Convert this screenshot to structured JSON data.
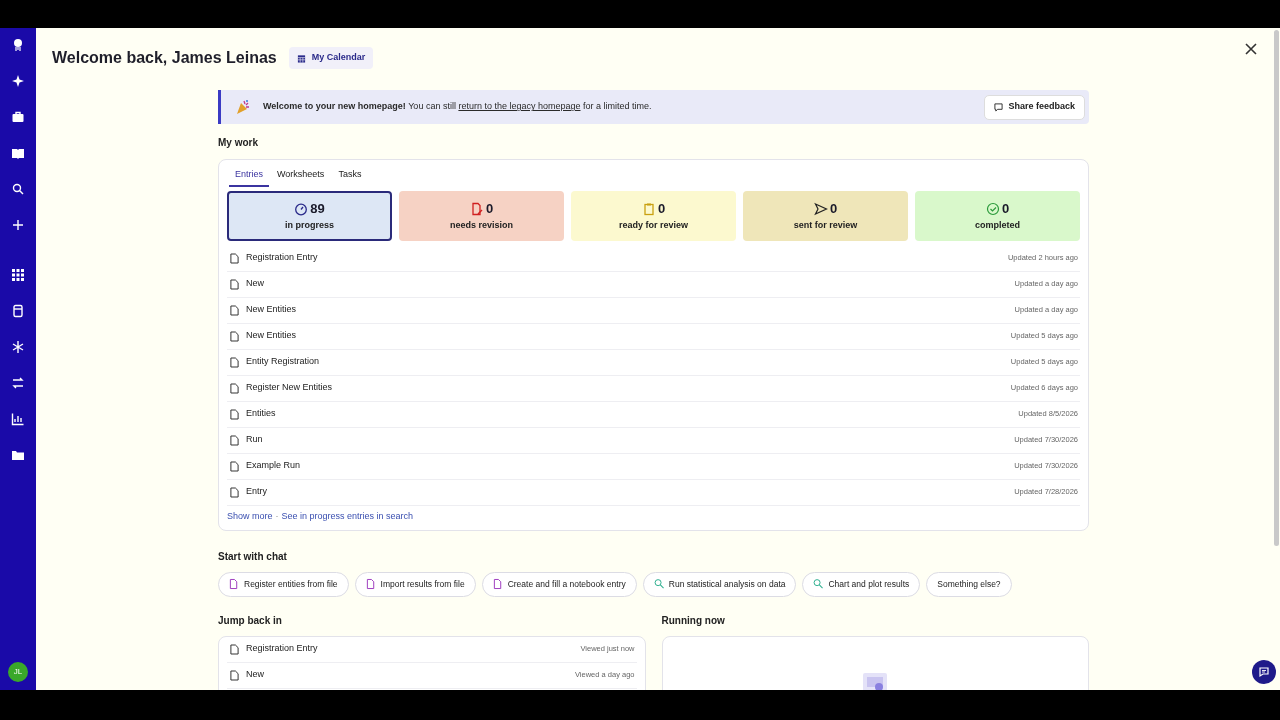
{
  "sidebar": {
    "icons": [
      {
        "kind": "logo"
      },
      {
        "kind": "sparkle"
      },
      {
        "kind": "briefcase"
      },
      {
        "kind": "book"
      },
      {
        "kind": "search"
      },
      {
        "kind": "plus"
      },
      {
        "kind": "grid"
      },
      {
        "kind": "cylinder"
      },
      {
        "kind": "snowflake"
      },
      {
        "kind": "arrows"
      },
      {
        "kind": "chart"
      },
      {
        "kind": "folder"
      }
    ],
    "avatar": "JL"
  },
  "header": {
    "title": "Welcome back, James Leinas",
    "calendar_button": "My Calendar"
  },
  "banner": {
    "lead": "Welcome to your new homepage!",
    "text": "You can still",
    "link": "return to the legacy homepage",
    "after": "for a limited time.",
    "button": "Share feedback"
  },
  "my_work": {
    "title": "My work",
    "tabs": [
      {
        "label": "Entries",
        "selected": true
      },
      {
        "label": "Worksheets",
        "selected": false
      },
      {
        "label": "Tasks",
        "selected": false
      }
    ],
    "status_cards": [
      {
        "kind": "progress",
        "count": "89",
        "label": "in progress",
        "selected": true,
        "color": "#dde7f5"
      },
      {
        "kind": "revision",
        "count": "0",
        "label": "needs revision",
        "selected": false,
        "color": "#f6d2c4"
      },
      {
        "kind": "ready",
        "count": "0",
        "label": "ready for review",
        "selected": false,
        "color": "#fcf9cf"
      },
      {
        "kind": "sent",
        "count": "0",
        "label": "sent for review",
        "selected": false,
        "color": "#efe6b9"
      },
      {
        "kind": "completed",
        "count": "0",
        "label": "completed",
        "selected": false,
        "color": "#d9f8cb"
      }
    ],
    "rows": [
      {
        "title": "Registration Entry",
        "updated": "Updated 2 hours ago"
      },
      {
        "title": "New",
        "updated": "Updated a day ago"
      },
      {
        "title": "New Entities",
        "updated": "Updated a day ago"
      },
      {
        "title": "New Entities",
        "updated": "Updated 5 days ago"
      },
      {
        "title": "Entity Registration",
        "updated": "Updated 5 days ago"
      },
      {
        "title": "Register New Entities",
        "updated": "Updated 6 days ago"
      },
      {
        "title": "Entities",
        "updated": "Updated 8/5/2026"
      },
      {
        "title": "Run",
        "updated": "Updated 7/30/2026"
      },
      {
        "title": "Example Run",
        "updated": "Updated 7/30/2026"
      },
      {
        "title": "Entry",
        "updated": "Updated 7/28/2026"
      }
    ],
    "footer_links": [
      "Show more",
      "See in progress entries in search"
    ],
    "separator": "·"
  },
  "start_with_chat": {
    "title": "Start with chat",
    "chips": [
      {
        "kind": "file",
        "label": "Register entities from file"
      },
      {
        "kind": "file",
        "label": "Import results from file"
      },
      {
        "kind": "file",
        "label": "Create and fill a notebook entry"
      },
      {
        "kind": "analysis",
        "label": "Run statistical analysis on data"
      },
      {
        "kind": "analysis",
        "label": "Chart and plot results"
      },
      {
        "kind": "plain",
        "label": "Something else?"
      }
    ]
  },
  "jump_back_in": {
    "title": "Jump back in",
    "rows": [
      {
        "title": "Registration Entry",
        "viewed": "Viewed just now"
      },
      {
        "title": "New",
        "viewed": "Viewed a day ago"
      }
    ]
  },
  "running_now": {
    "title": "Running now"
  }
}
